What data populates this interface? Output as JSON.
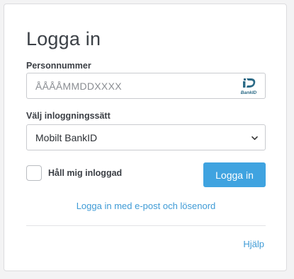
{
  "login": {
    "title": "Logga in",
    "personal_number": {
      "label": "Personnummer",
      "placeholder": "ÅÅÅÅMMDDXXXX",
      "value": "",
      "icon": "bankid-icon"
    },
    "method": {
      "label": "Välj inloggningssätt",
      "selected": "Mobilt BankID",
      "icon": "chevron-down-icon"
    },
    "remember_me": {
      "label": "Håll mig inloggad",
      "checked": false
    },
    "submit_label": "Logga in",
    "alt_login_link": "Logga in med e-post och lösenord",
    "help_link": "Hjälp"
  },
  "colors": {
    "accent": "#3fa3e0",
    "link": "#3f9bd6",
    "title": "#3c4147",
    "bankid_logo": "#2b6a86"
  }
}
